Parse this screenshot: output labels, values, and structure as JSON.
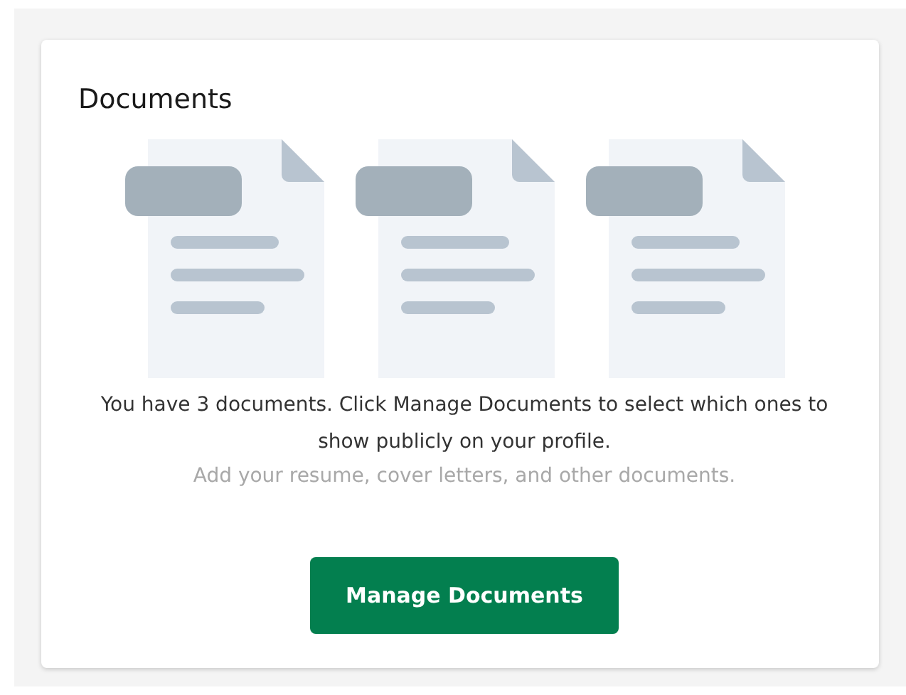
{
  "card": {
    "title": "Documents",
    "message": "You have 3 documents. Click Manage Documents to select which ones to show publicly on your profile.",
    "hint": "Add your resume, cover letters, and other documents.",
    "button": "Manage Documents"
  }
}
